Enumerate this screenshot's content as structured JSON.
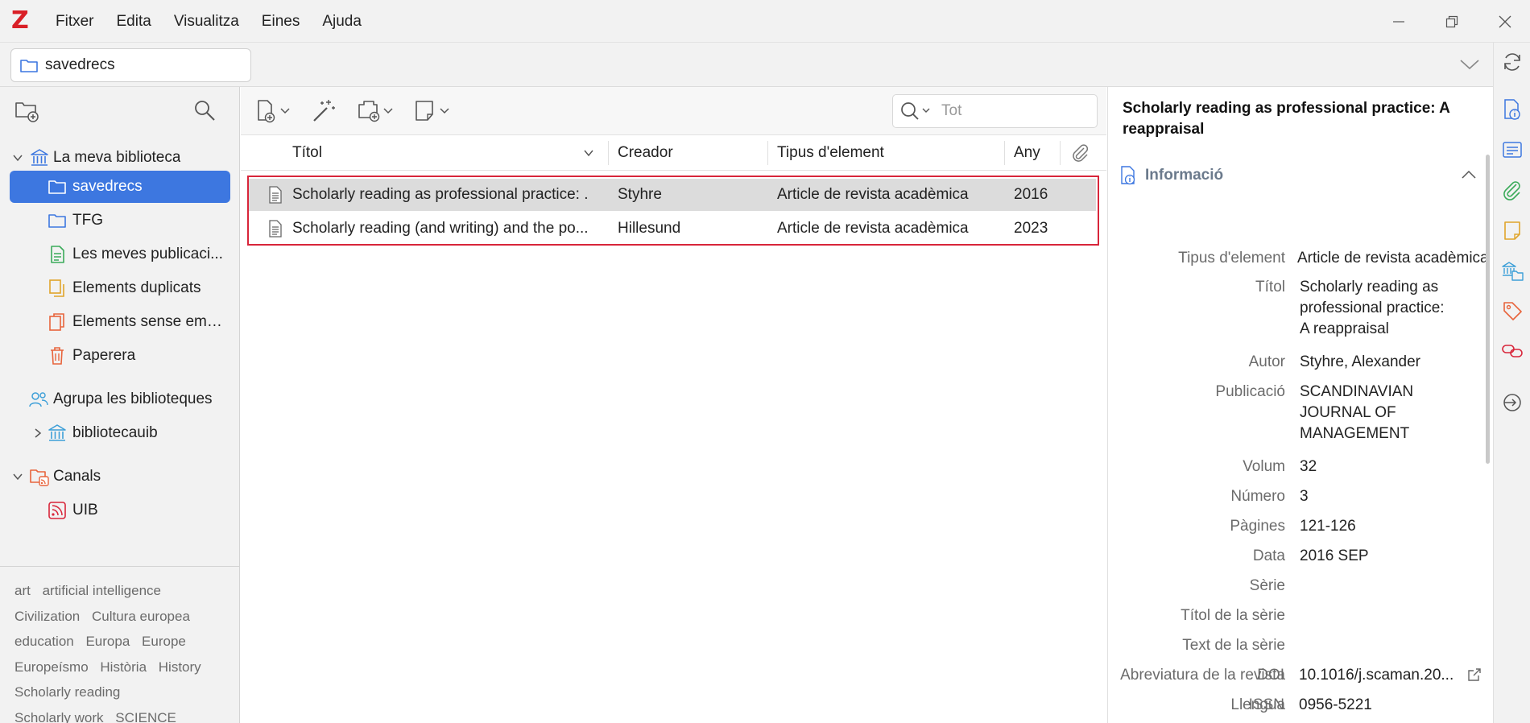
{
  "app": {
    "logo": "Z"
  },
  "menu": [
    "Fitxer",
    "Edita",
    "Visualitza",
    "Eines",
    "Ajuda"
  ],
  "collection_header": {
    "current": "savedrecs"
  },
  "library_tree": {
    "my_library": "La meva biblioteca",
    "items": [
      {
        "label": "savedrecs"
      },
      {
        "label": "TFG"
      },
      {
        "label": "Les meves publicaci..."
      },
      {
        "label": "Elements duplicats"
      },
      {
        "label": "Elements sense emp..."
      },
      {
        "label": "Paperera"
      }
    ],
    "group_libraries": "Agrupa les biblioteques",
    "group_item": "bibliotecauib",
    "feeds": "Canals",
    "feed_item": "UIB"
  },
  "tags": [
    "art",
    "artificial intelligence",
    "Civilization",
    "Cultura europea",
    "education",
    "Europa",
    "Europe",
    "Europeísmo",
    "Història",
    "History",
    "Scholarly reading",
    "Scholarly work",
    "SCIENCE"
  ],
  "search": {
    "placeholder": "Tot"
  },
  "columns": {
    "title": "Títol",
    "creator": "Creador",
    "type": "Tipus d'element",
    "year": "Any"
  },
  "rows": [
    {
      "title": "Scholarly reading as professional practice: ...",
      "creator": "Styhre",
      "type": "Article de revista acadèmica",
      "year": "2016"
    },
    {
      "title": "Scholarly reading (and writing) and the po...",
      "creator": "Hillesund",
      "type": "Article de revista acadèmica",
      "year": "2023"
    }
  ],
  "item_pane": {
    "title": "Scholarly reading as professional practice: A reappraisal",
    "section": "Informació",
    "fields": [
      {
        "label": "Tipus d'element",
        "value": "Article de revista acadèmica"
      },
      {
        "label": "Títol",
        "value": "Scholarly reading as\nprofessional practice:\nA reappraisal"
      },
      {
        "label": "Autor",
        "value": "Styhre, Alexander"
      },
      {
        "label": "Publicació",
        "value": "SCANDINAVIAN\nJOURNAL OF\nMANAGEMENT"
      },
      {
        "label": "Volum",
        "value": "32"
      },
      {
        "label": "Número",
        "value": "3"
      },
      {
        "label": "Pàgines",
        "value": "121-126"
      },
      {
        "label": "Data",
        "value": "2016 SEP"
      },
      {
        "label": "Sèrie",
        "value": ""
      },
      {
        "label": "Títol de la sèrie",
        "value": ""
      },
      {
        "label": "Text de la sèrie",
        "value": ""
      },
      {
        "label": "Abreviatura de la revista",
        "value": ""
      },
      {
        "label": "Llengua",
        "value": ""
      },
      {
        "label": "DOI",
        "value": "10.1016/j.scaman.20..."
      },
      {
        "label": "ISSN",
        "value": "0956-5221"
      }
    ]
  },
  "colors": {
    "accent": "#3d77e0",
    "brand": "#d92027",
    "highlight": "#d8253a"
  }
}
